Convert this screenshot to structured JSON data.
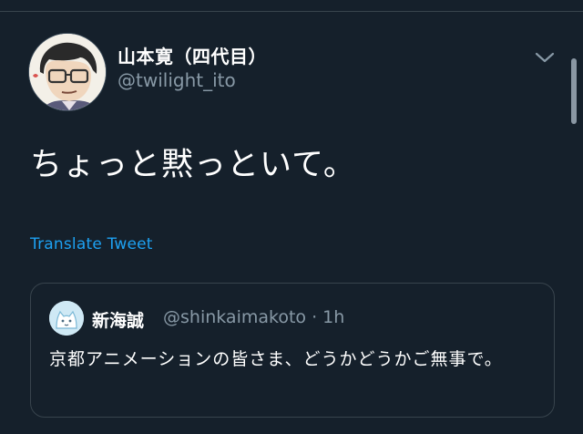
{
  "tweet": {
    "author_name": "山本寛（四代目）",
    "author_handle": "@twilight_ito",
    "text": "ちょっと黙っといて。",
    "translate_label": "Translate Tweet"
  },
  "quoted_tweet": {
    "author_name": "新海誠",
    "author_handle": "@shinkaimakoto · 1h",
    "text": "京都アニメーションの皆さま、どうかどうかご無事で。"
  },
  "icons": {
    "menu": "chevron-down-icon"
  },
  "colors": {
    "background": "#15202b",
    "link": "#1da1f2",
    "muted": "#8899a6",
    "border": "#38444d"
  }
}
